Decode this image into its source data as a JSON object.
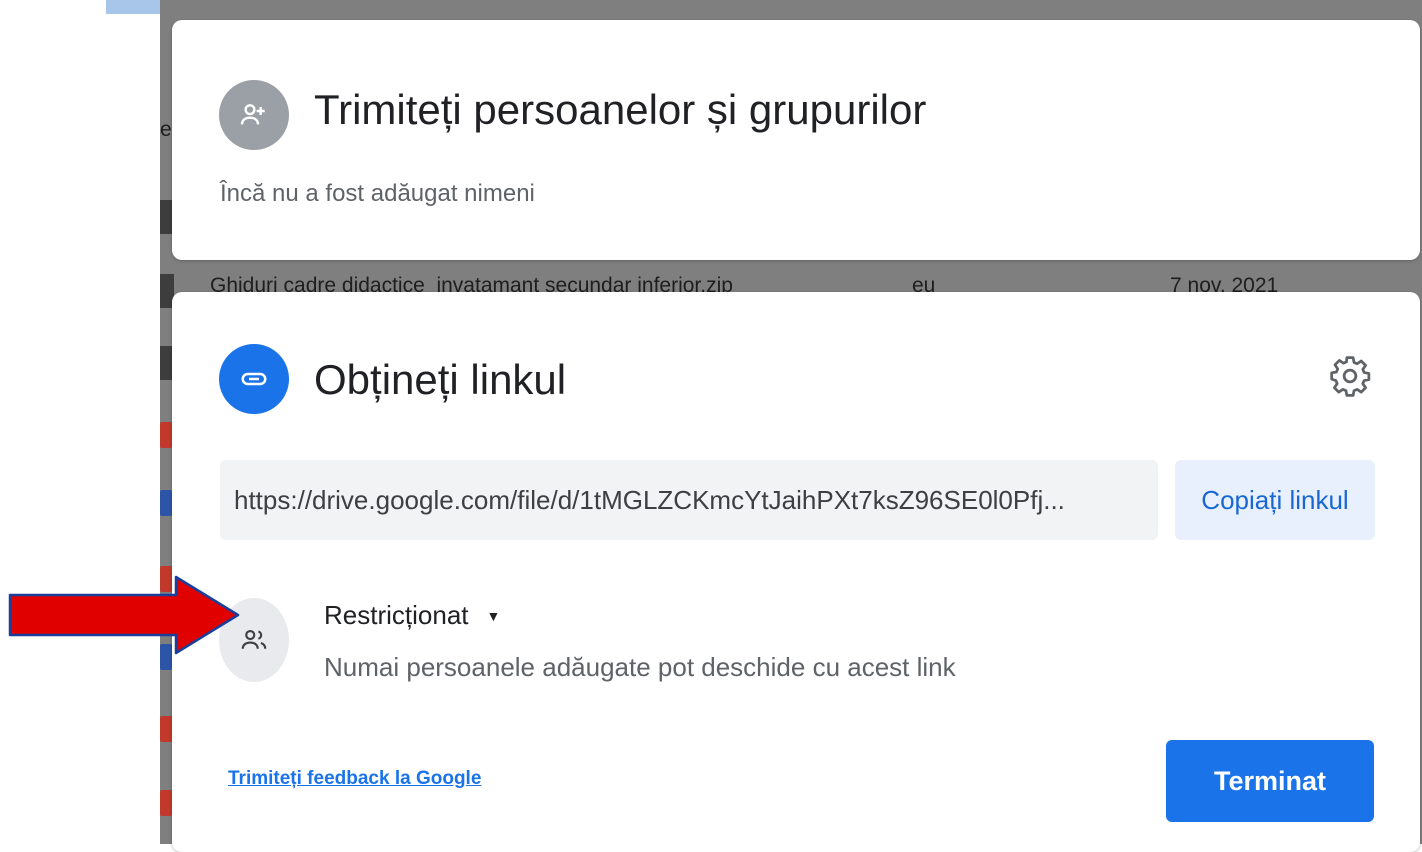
{
  "share_people": {
    "title": "Trimiteți persoanelor și grupurilor",
    "empty_text": "Încă nu a fost adăugat nimeni",
    "icon": "add-person-icon"
  },
  "get_link": {
    "title": "Obțineți linkul",
    "icon": "link-icon",
    "settings_icon": "gear-icon",
    "url": "https://drive.google.com/file/d/1tMGLZCKmcYtJaihPXt7ksZ96SE0l0Pfj...",
    "copy_label": "Copiați linkul",
    "access_level": "Restricționat",
    "access_description": "Numai persoanele adăugate pot deschide cu acest link",
    "access_icon": "people-icon"
  },
  "footer": {
    "feedback_label": "Trimiteți feedback la Google",
    "done_label": "Terminat"
  },
  "background": {
    "file_name": "Ghiduri cadre didactice_invatamant secundar inferior.zip",
    "owner": "eu",
    "date": "7 nov. 2021",
    "partial_label": "e"
  },
  "colors": {
    "accent": "#1a73e8",
    "copy_button_bg": "#e8f0fe",
    "annotation_arrow": "#e00000"
  }
}
